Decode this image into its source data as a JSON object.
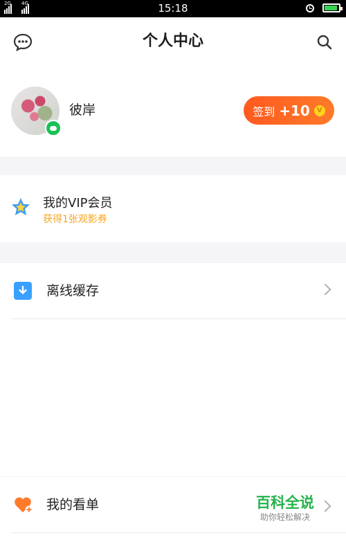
{
  "status_bar": {
    "sim1": "2G",
    "sim2": "4G",
    "time": "15:18",
    "battery_color": "#39d353"
  },
  "header": {
    "title": "个人中心",
    "left_icon": "message-icon",
    "right_icon": "search-icon"
  },
  "profile": {
    "username": "彼岸",
    "checkin_label": "签到",
    "checkin_points": "+10",
    "coin_glyph": "V",
    "accent": "#ff6a26"
  },
  "vip": {
    "title": "我的VIP会员",
    "subtitle": "获得1张观影券",
    "subtitle_color": "#f6a623"
  },
  "menu": {
    "offline": "离线缓存",
    "watchlist": "我的看单"
  },
  "watermark": {
    "title": "百科全说",
    "subtitle": "助你轻松解决"
  }
}
